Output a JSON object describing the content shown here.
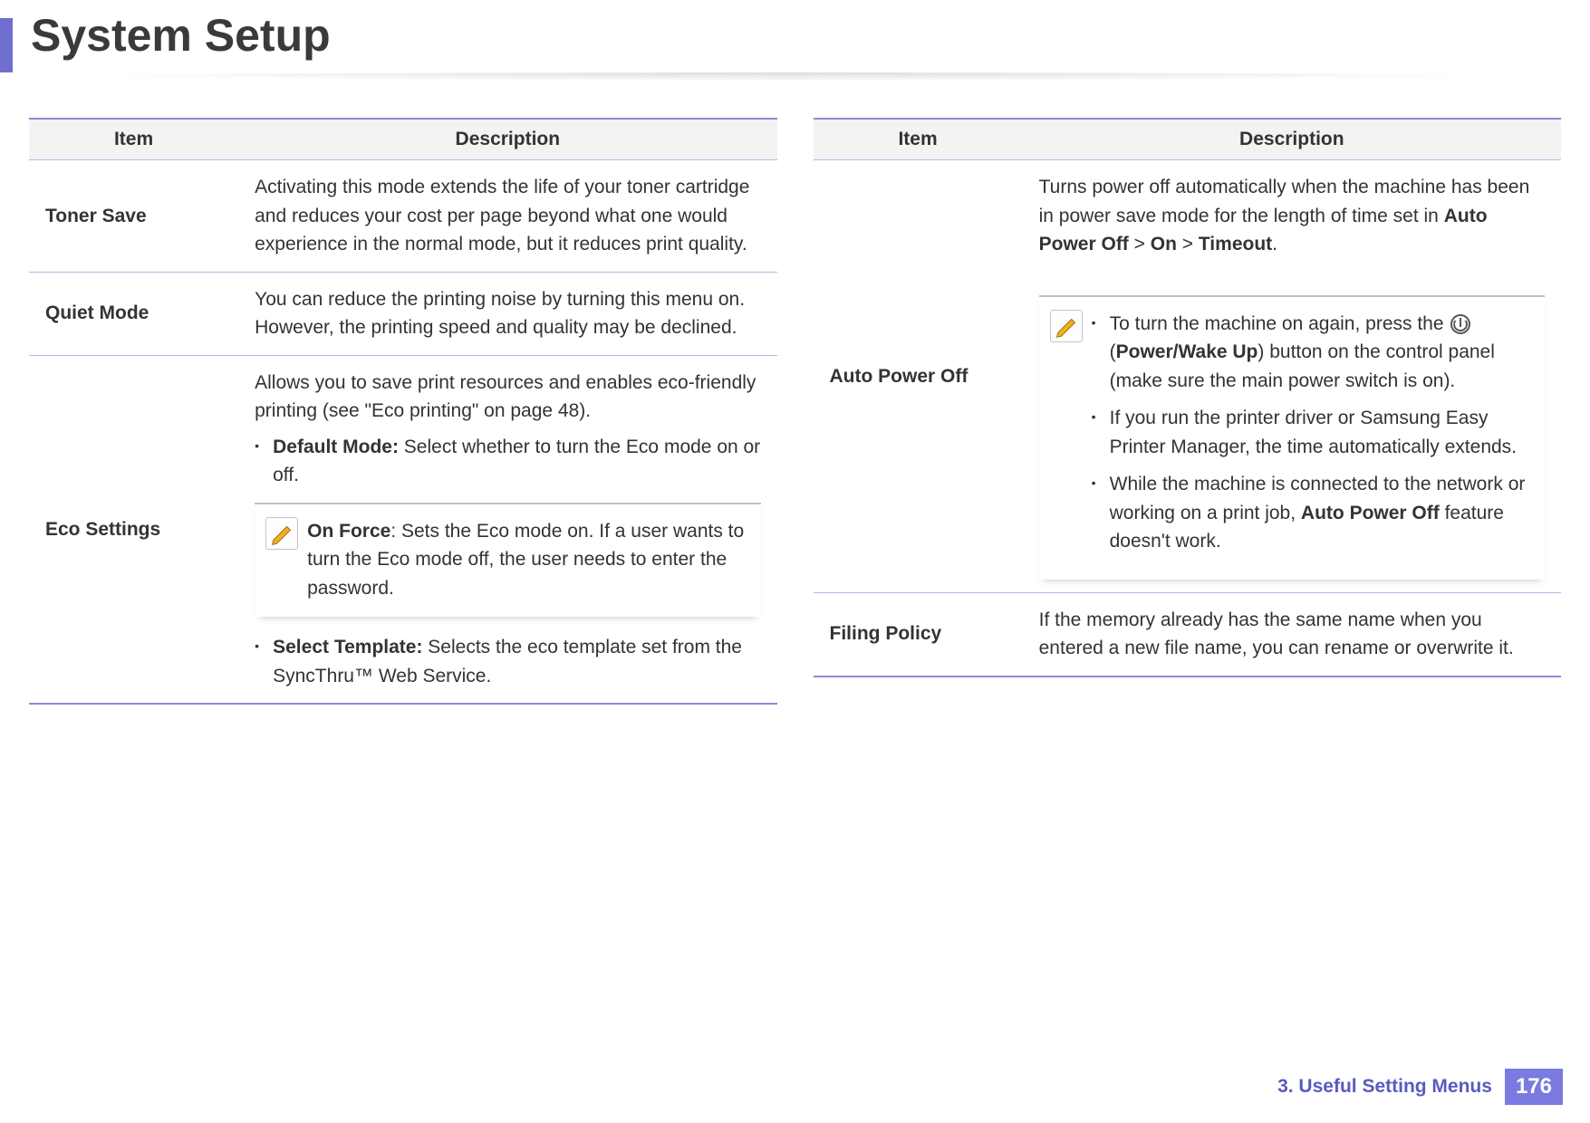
{
  "page_title": "System Setup",
  "headers": {
    "item": "Item",
    "description": "Description"
  },
  "left_table": [
    {
      "item": "Toner Save",
      "desc": "Activating this mode extends the life of your toner cartridge and reduces your cost per page beyond what one would experience in the normal mode, but it reduces print quality."
    },
    {
      "item": "Quiet Mode",
      "desc": "You can reduce the printing noise by turning this menu on. However, the printing speed and quality may be declined."
    },
    {
      "item": "Eco Settings",
      "intro": "Allows you to save print resources and enables eco-friendly printing (see \"Eco printing\" on page 48).",
      "bullet1_label": "Default Mode:",
      "bullet1_text": " Select whether to turn the Eco mode on or off.",
      "note_label": "On Force",
      "note_text": ": Sets the Eco mode on. If a user wants to turn the Eco mode off, the user needs to enter the password.",
      "bullet2_label": "Select Template:",
      "bullet2_text": " Selects the eco template set from the SyncThru™ Web Service."
    }
  ],
  "right_table": [
    {
      "item": "Auto Power Off",
      "intro_pre": "Turns power off automatically when the machine has been in power save mode for the length of time set in ",
      "intro_bold1": "Auto Power Off",
      "intro_sep1": " > ",
      "intro_bold2": "On",
      "intro_sep2": " > ",
      "intro_bold3": "Timeout",
      "intro_post": ".",
      "note_b1_pre": "To turn the machine on again, press the ",
      "note_b1_mid": " (",
      "note_b1_bold": "Power/Wake Up",
      "note_b1_post": ") button on the control panel (make sure the main power switch is on).",
      "note_b2": "If you run the printer driver or Samsung Easy Printer Manager, the time automatically extends.",
      "note_b3_pre": "While the machine is connected to the network or working on a print job, ",
      "note_b3_bold": "Auto Power Off",
      "note_b3_post": " feature doesn't work."
    },
    {
      "item": "Filing Policy",
      "desc": "If the memory already has the same name when you entered a new file name, you can rename or overwrite it."
    }
  ],
  "footer": {
    "chapter": "3.  Useful Setting Menus",
    "page": "176"
  }
}
